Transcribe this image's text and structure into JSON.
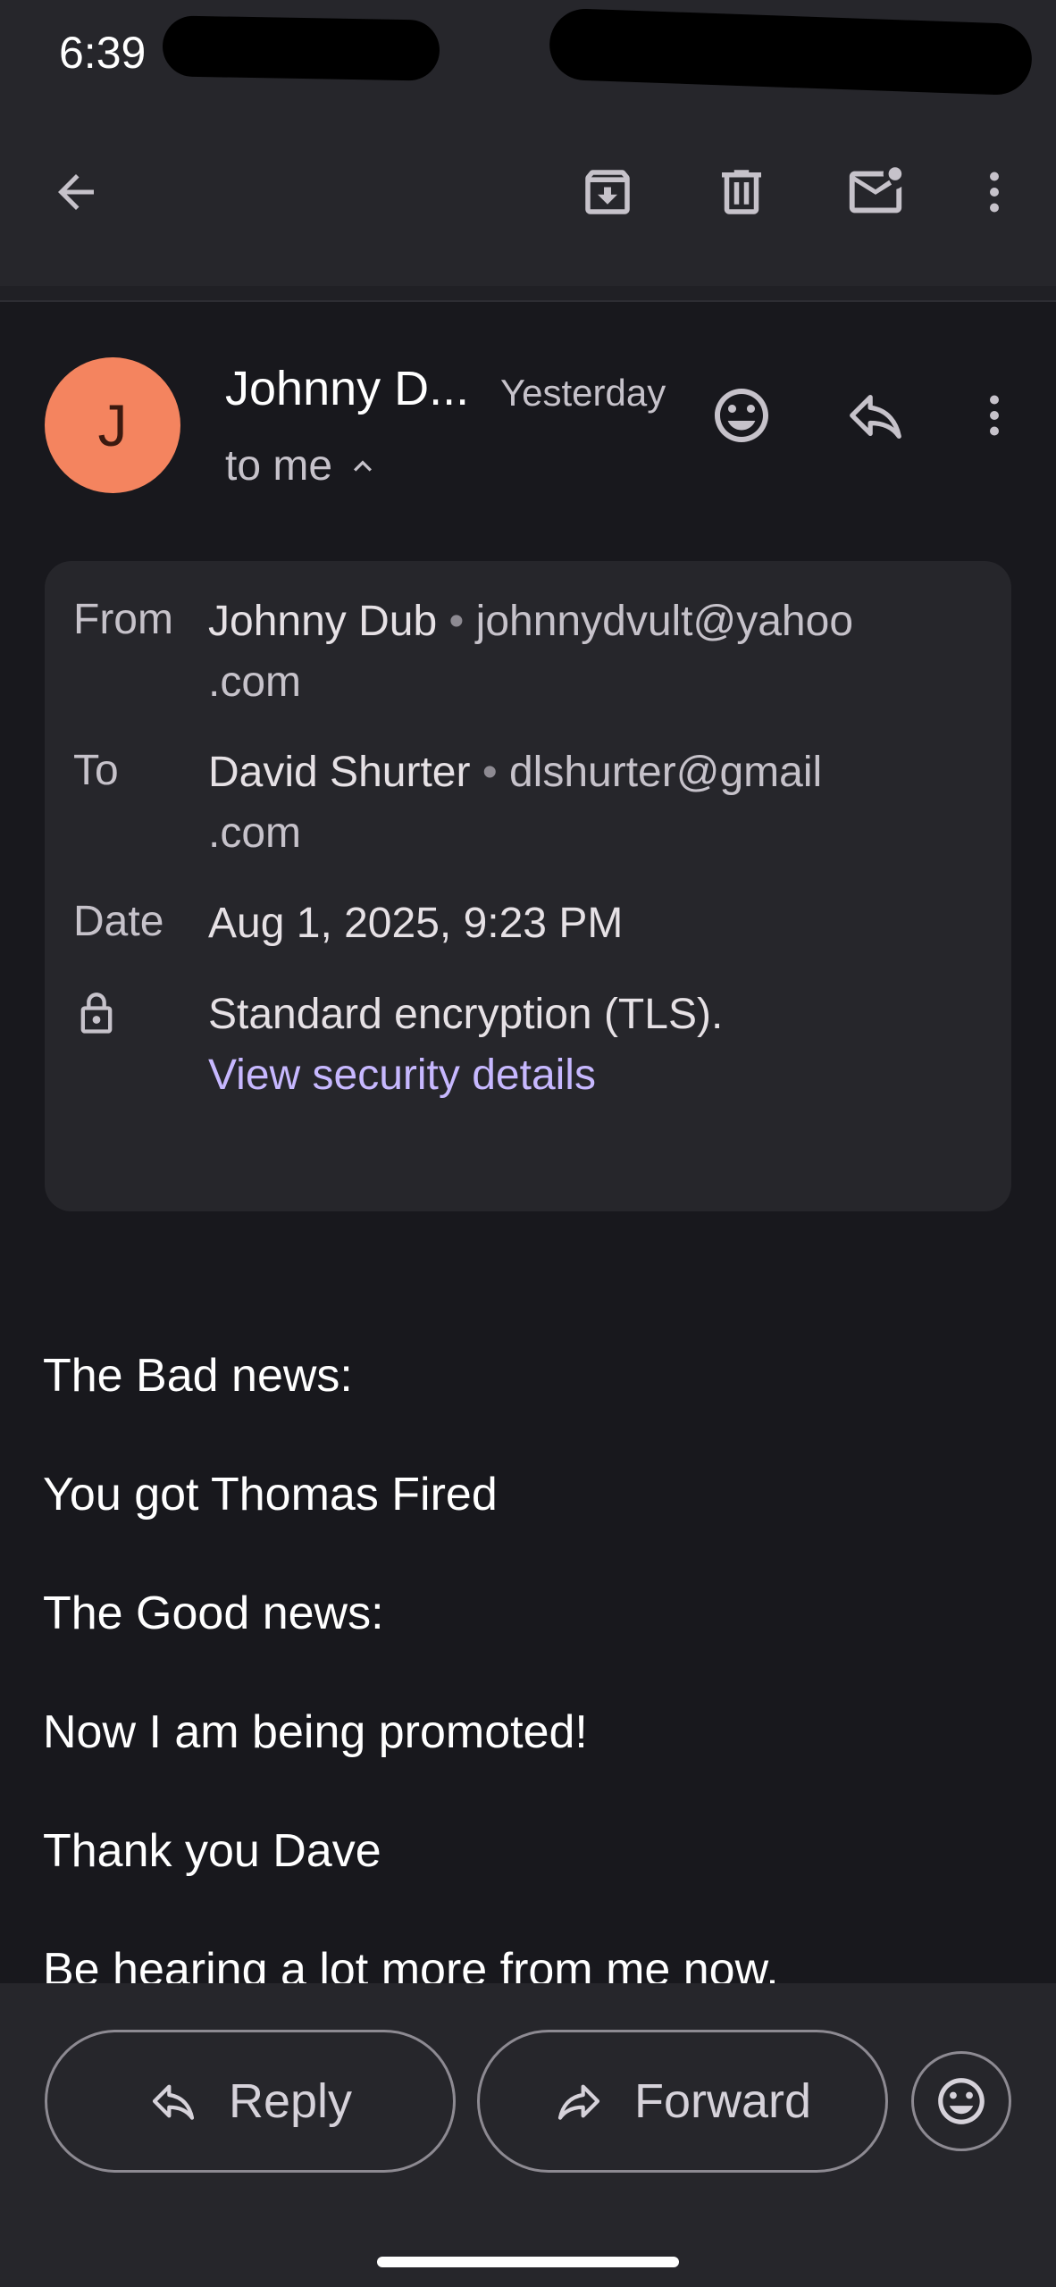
{
  "status_bar": {
    "time": "6:39"
  },
  "toolbar": {
    "back_icon": "arrow-back-icon",
    "archive_icon": "archive-icon",
    "delete_icon": "trash-icon",
    "mark_unread_icon": "mail-unread-icon",
    "more_icon": "more-vert-icon"
  },
  "message": {
    "avatar_letter": "J",
    "sender_short": "Johnny D...",
    "time": "Yesterday",
    "to_me": "to me",
    "details": {
      "from_label": "From",
      "from_name": "Johnny Dub",
      "from_email_line1": "johnnydvult@yahoo",
      "from_email_line2": ".com",
      "to_label": "To",
      "to_name": "David Shurter",
      "to_email_line1": "dlshurter@gmail",
      "to_email_line2": ".com",
      "date_label": "Date",
      "date_value": "Aug 1, 2025, 9:23 PM",
      "encryption": "Standard encryption (TLS).",
      "security_link": "View security details",
      "separator": "•"
    },
    "body": [
      "The Bad news:",
      "You got Thomas Fired",
      "The Good news:",
      "Now I am being promoted!",
      "Thank you Dave",
      "Be hearing a lot more from me now."
    ]
  },
  "actions": {
    "reply_label": "Reply",
    "forward_label": "Forward"
  },
  "colors": {
    "avatar_bg": "#f4845f",
    "link": "#c7b8ff",
    "background": "#18181d",
    "surface": "#26262b"
  }
}
